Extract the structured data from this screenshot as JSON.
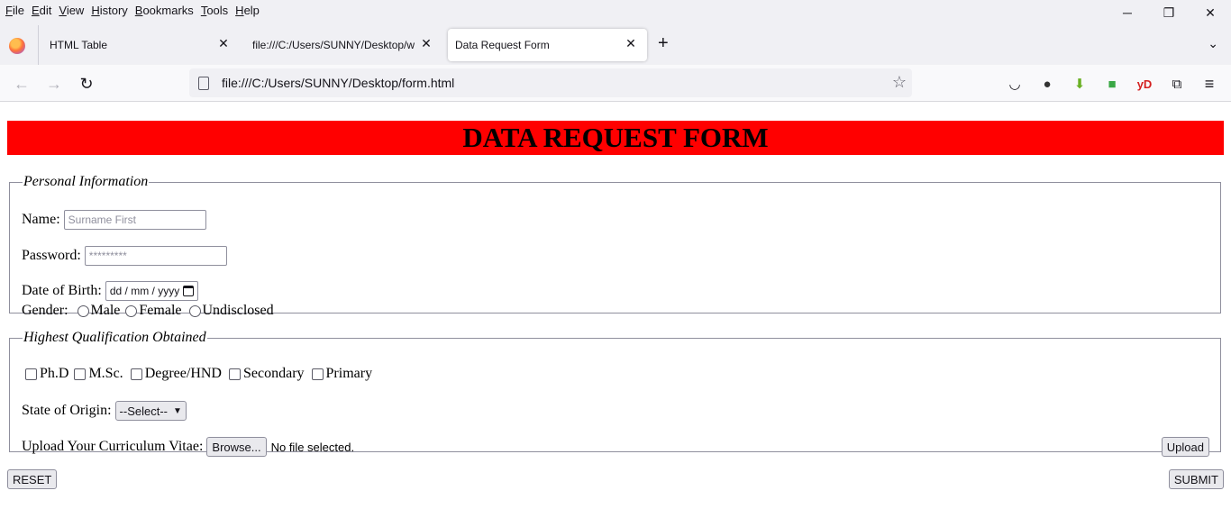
{
  "menu": [
    "File",
    "Edit",
    "View",
    "History",
    "Bookmarks",
    "Tools",
    "Help"
  ],
  "window_controls": {
    "minimize": "─",
    "restore": "❐",
    "close": "✕"
  },
  "tabs": [
    {
      "label": "HTML Table",
      "close": "✕"
    },
    {
      "label": "file:///C:/Users/SUNNY/Desktop/we",
      "close": "✕"
    },
    {
      "label": "Data Request Form",
      "close": "✕"
    }
  ],
  "new_tab": "+",
  "tab_list": "⌄",
  "nav": {
    "back": "←",
    "forward": "→",
    "reload": "↻"
  },
  "url": "file:///C:/Users/SUNNY/Desktop/form.html",
  "bookmark_star": "☆",
  "toolbar": {
    "pocket": "◡",
    "ext1": "●",
    "ext2": "⬇",
    "ext3": "■",
    "ext4": "yD",
    "extensions": "⧉",
    "menu": "≡"
  },
  "colors": {
    "title_bg": "#ff0000",
    "active_tab_bg": "#ffffff",
    "chrome_bg": "#f0f0f4"
  },
  "page": {
    "title": "DATA REQUEST FORM",
    "personal": {
      "legend": "Personal Information",
      "name_label": "Name:",
      "name_placeholder": "Surname First",
      "password_label": "Password:",
      "password_placeholder": "*********",
      "dob_label": "Date of Birth:",
      "dob_placeholder": "dd / mm / yyyy",
      "gender_label": "Gender:",
      "gender_options": [
        "Male",
        "Female",
        "Undisclosed"
      ]
    },
    "qualification": {
      "legend": "Highest Qualification Obtained",
      "options": [
        "Ph.D",
        "M.Sc.",
        "Degree/HND",
        "Secondary",
        "Primary"
      ],
      "state_label": "State of Origin:",
      "state_selected": "--Select--",
      "cv_label": "Upload Your Curriculum Vitae:",
      "browse_label": "Browse...",
      "no_file": "No file selected.",
      "upload_label": "Upload"
    },
    "reset_label": "RESET",
    "submit_label": "SUBMIT"
  }
}
